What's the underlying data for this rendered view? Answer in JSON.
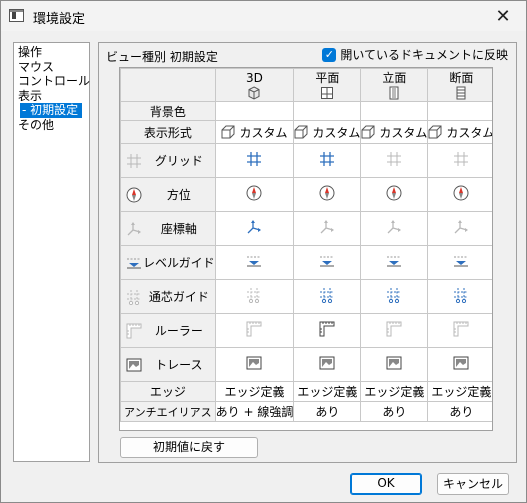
{
  "window": {
    "title": "環境設定",
    "close_glyph": "✕"
  },
  "nav": {
    "items": [
      {
        "label": "操作",
        "selected": false
      },
      {
        "label": "マウス",
        "selected": false
      },
      {
        "label": "コントロール",
        "selected": false
      },
      {
        "label": "表示",
        "selected": false
      },
      {
        "label": "- 初期設定",
        "selected": true
      },
      {
        "label": "その他",
        "selected": false
      }
    ]
  },
  "panel": {
    "label": "ビュー種別 初期設定",
    "open_docs_checkbox": {
      "label": "開いているドキュメントに反映",
      "checked": true,
      "mark": "✓"
    }
  },
  "table": {
    "columns": [
      {
        "label": "3D",
        "icon": "cube-icon"
      },
      {
        "label": "平面",
        "icon": "plan-icon"
      },
      {
        "label": "立面",
        "icon": "elevation-icon"
      },
      {
        "label": "断面",
        "icon": "section-icon"
      }
    ],
    "rows": {
      "background": {
        "label": "背景色"
      },
      "display_style": {
        "label": "表示形式",
        "value": "カスタム",
        "icon": "cube-style-icon"
      },
      "grid": {
        "label": "グリッド",
        "icon": "grid-icon"
      },
      "compass": {
        "label": "方位",
        "icon": "compass-icon"
      },
      "axes": {
        "label": "座標軸",
        "icon": "axes-icon"
      },
      "level_guide": {
        "label": "レベルガイド",
        "icon": "level-guide-icon"
      },
      "core_guide": {
        "label": "通芯ガイド",
        "icon": "core-guide-icon"
      },
      "ruler": {
        "label": "ルーラー",
        "icon": "ruler-icon"
      },
      "trace": {
        "label": "トレース",
        "icon": "trace-icon"
      },
      "edge": {
        "label": "エッジ",
        "values": [
          "エッジ定義",
          "エッジ定義",
          "エッジ定義",
          "エッジ定義"
        ]
      },
      "antialias": {
        "label": "アンチエイリアス",
        "values": [
          "あり + 線強調",
          "あり",
          "あり",
          "あり"
        ]
      }
    }
  },
  "buttons": {
    "reset": "初期値に戻す",
    "ok": "OK",
    "cancel": "キャンセル"
  },
  "colors": {
    "accent": "#0078d7",
    "icon_blue": "#2e6fbe",
    "compass_red": "#d9352a",
    "disabled_gray": "#b8b8b8"
  }
}
